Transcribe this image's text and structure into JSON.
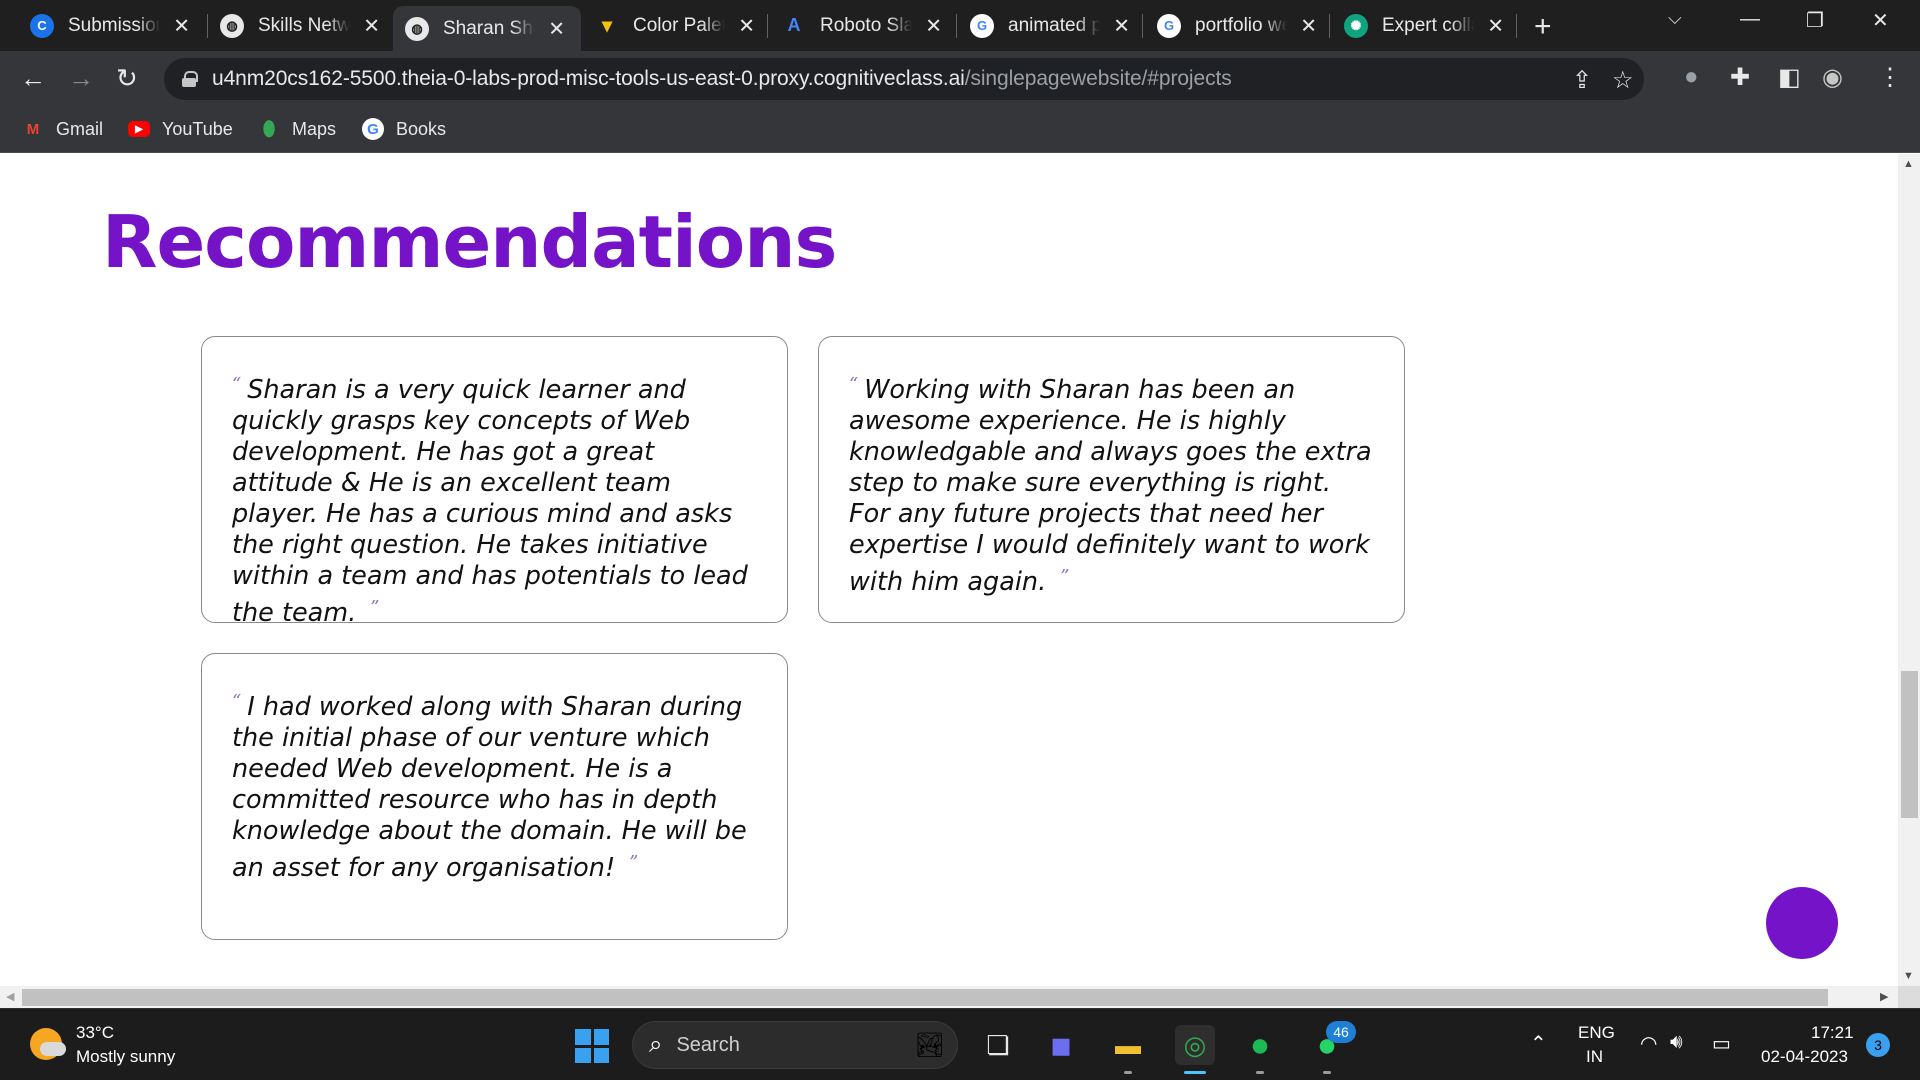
{
  "browser": {
    "tabs": [
      {
        "title": "Submission",
        "icon": "coursera-c-icon",
        "color": "#1a73e8"
      },
      {
        "title": "Skills Network",
        "icon": "globe-icon",
        "color": "#e8e8e8"
      },
      {
        "title": "Sharan Shetty",
        "icon": "globe-icon",
        "color": "#e8e8e8",
        "active": true
      },
      {
        "title": "Color Palette",
        "icon": "palette-icon",
        "color": "#f4c20d"
      },
      {
        "title": "Roboto Slab",
        "icon": "google-fonts-icon",
        "color": "#4285f4"
      },
      {
        "title": "animated portfolio",
        "icon": "google-g-icon",
        "color": "#4285f4"
      },
      {
        "title": "portfolio website",
        "icon": "google-g-icon",
        "color": "#4285f4"
      },
      {
        "title": "Expert collaboration",
        "icon": "chatgpt-icon",
        "color": "#10a37f"
      }
    ],
    "address": {
      "host": "u4nm20cs162-5500.theia-0-labs-prod-misc-tools-us-east-0.proxy.cognitiveclass.ai",
      "path": "/singlepagewebsite/#projects"
    },
    "bookmarks": [
      {
        "label": "Gmail",
        "icon": "gmail-icon"
      },
      {
        "label": "YouTube",
        "icon": "youtube-icon"
      },
      {
        "label": "Maps",
        "icon": "maps-icon"
      },
      {
        "label": "Books",
        "icon": "google-g-icon"
      }
    ]
  },
  "page": {
    "heading": "Recommendations",
    "accent": "#7413c8",
    "recommendations": [
      {
        "text": "Sharan is a very quick learner and quickly grasps key concepts of Web development. He has got a great attitude & He is an excellent team player. He has a curious mind and asks the right question. He takes initiative within a team and has potentials to lead the team."
      },
      {
        "text": "Working with Sharan has been an awesome experience. He is highly knowledgable and always goes the extra step to make sure everything is right. For any future projects that need her expertise I would definitely want to work with him again."
      },
      {
        "text": "I had worked along with Sharan during the initial phase of our venture which needed Web development. He is a committed resource who has in depth knowledge about the domain. He will be an asset for any organisation!"
      }
    ],
    "quote_open": "“",
    "quote_close": "”"
  },
  "taskbar": {
    "weather": {
      "temp": "33°C",
      "desc": "Mostly sunny"
    },
    "search_label": "Search",
    "whatsapp_badge": "46",
    "language": {
      "line1": "ENG",
      "line2": "IN"
    },
    "clock": {
      "time": "17:21",
      "date": "02-04-2023"
    },
    "notifications": "3"
  }
}
